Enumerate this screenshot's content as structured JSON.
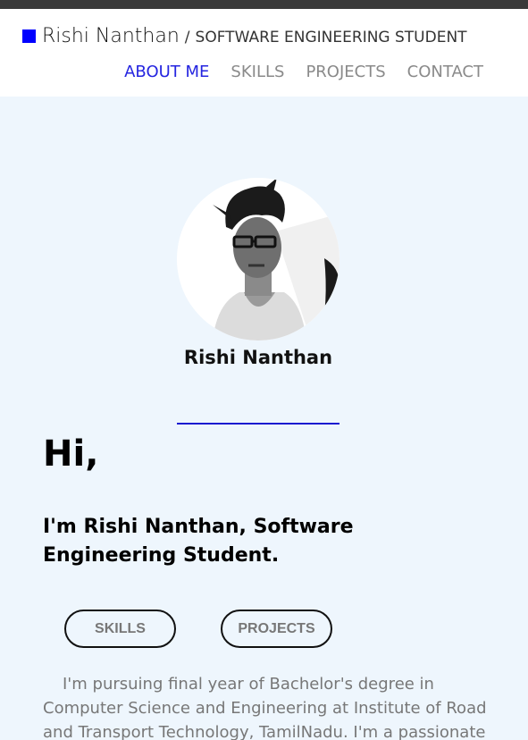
{
  "header": {
    "brand_name": "Rishi Nanthan",
    "brand_separator": "/",
    "brand_subtitle": "SOFTWARE ENGINEERING STUDENT",
    "nav": [
      {
        "label": "ABOUT ME",
        "active": true
      },
      {
        "label": "SKILLS",
        "active": false
      },
      {
        "label": "PROJECTS",
        "active": false
      },
      {
        "label": "CONTACT",
        "active": false
      }
    ]
  },
  "profile": {
    "name": "Rishi Nanthan"
  },
  "hero": {
    "greeting": "Hi,",
    "intro": "I'm Rishi Nanthan, Software Engineering Student."
  },
  "buttons": {
    "skills": "SKILLS",
    "projects": "PROJECTS"
  },
  "bio": {
    "text": "I'm pursuing final year of Bachelor's degree in Computer Science and Engineering at Institute of Road and Transport Technology, TamilNadu. I'm a passionate"
  },
  "colors": {
    "accent": "#0000ff",
    "nav_active": "#2525e0",
    "background": "#eef6fd"
  }
}
